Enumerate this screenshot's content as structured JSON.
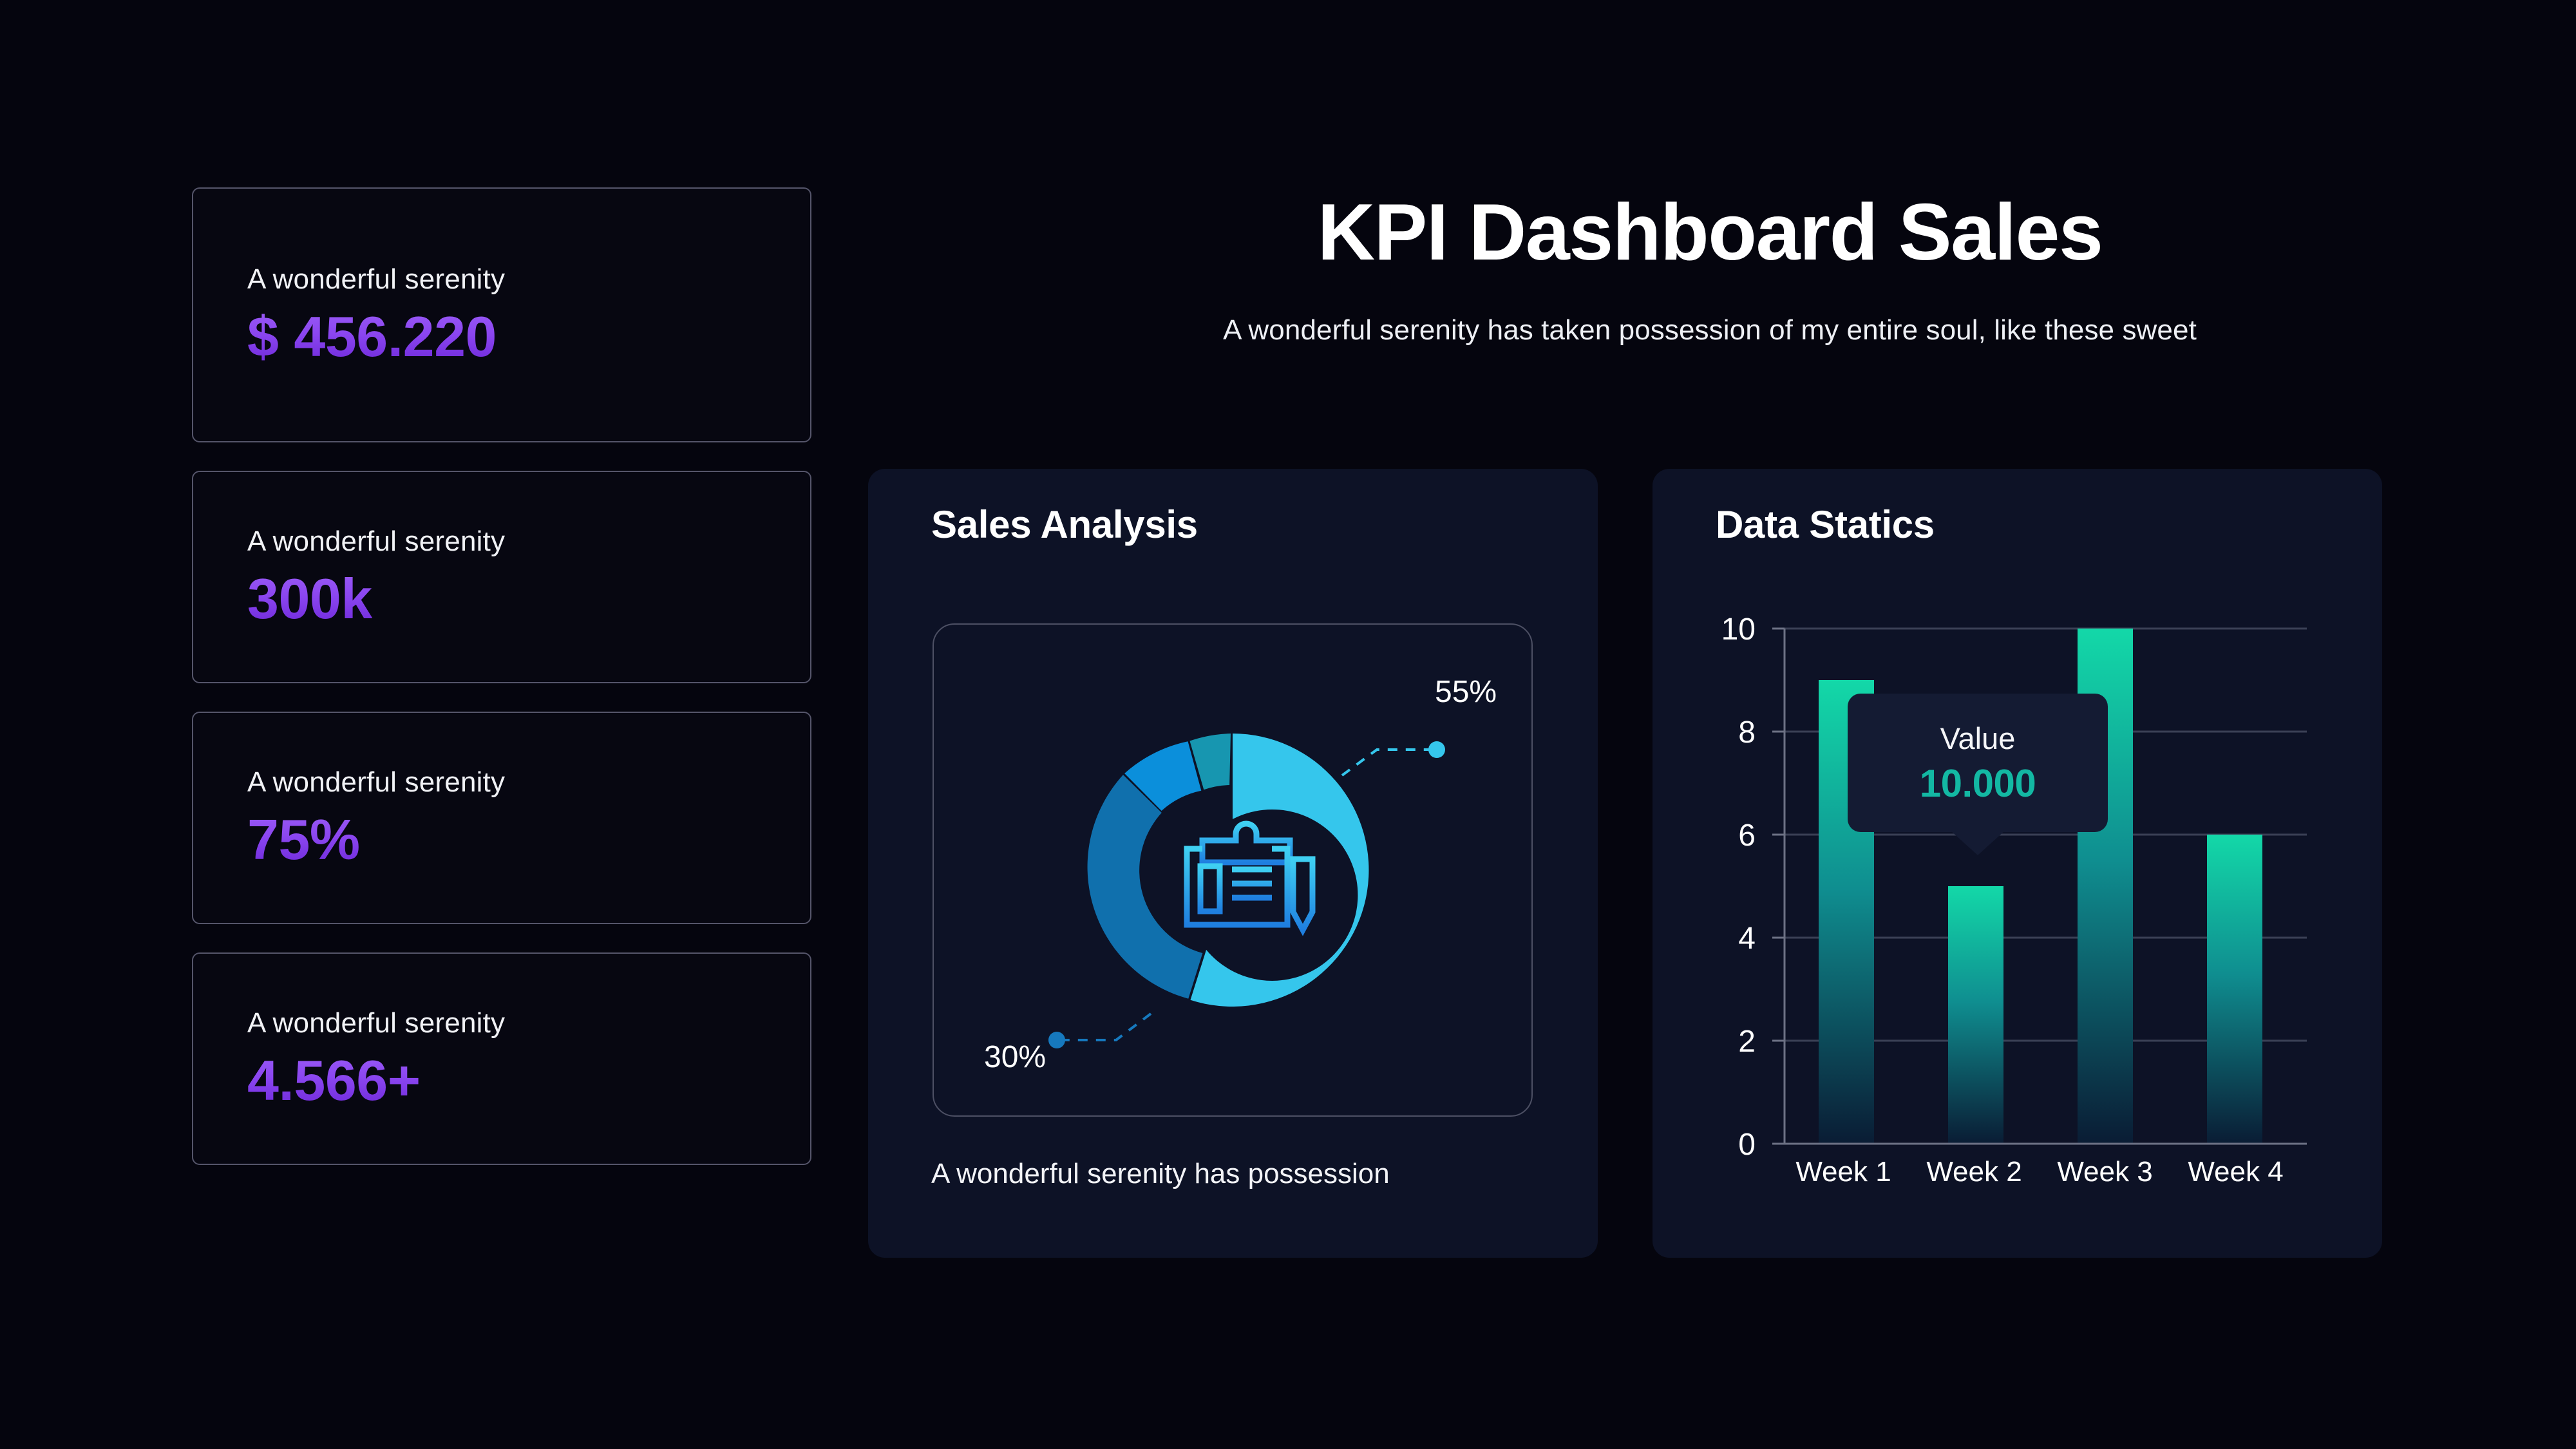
{
  "header": {
    "title": "KPI Dashboard Sales",
    "subtitle": "A wonderful serenity has taken possession of my entire soul, like these sweet"
  },
  "theme": {
    "page_bg": "#05050e",
    "panel_bg": "#0d1226",
    "kpi_accent_light": "#9b5cf6",
    "kpi_accent_dark": "#6d28d9",
    "bar_accent": "#13d8a8",
    "tooltip_accent": "#13b8a3",
    "donut_primary": "#35c6ec"
  },
  "kpi_cards": [
    {
      "label": "A wonderful serenity",
      "value": "$ 456.220"
    },
    {
      "label": "A wonderful serenity",
      "value": "300k"
    },
    {
      "label": "A wonderful serenity",
      "value": "75%"
    },
    {
      "label": "A wonderful serenity",
      "value": "4.566+"
    }
  ],
  "sales_panel": {
    "title": "Sales Analysis",
    "caption": "A wonderful serenity has possession",
    "center_icon": "clipboard-pencil-icon",
    "callouts": [
      {
        "text": "55%",
        "dot_color": "#35c6ec"
      },
      {
        "text": "30%",
        "dot_color": "#1679be"
      }
    ]
  },
  "stats_panel": {
    "title": "Data Statics",
    "tooltip": {
      "label": "Value",
      "value": "10.000"
    }
  },
  "chart_data": [
    {
      "type": "pie",
      "title": "Sales Analysis",
      "subtype": "donut",
      "labels": [
        "55%",
        "30%",
        "10%",
        "5%"
      ],
      "values": [
        55,
        30,
        10,
        5
      ],
      "colors": [
        "#35c6ec",
        "#1070ad",
        "#0b8fdb",
        "#1796b0"
      ],
      "annotations": [
        "55%",
        "30%"
      ],
      "legend": "none",
      "start_angle_deg": 0,
      "direction": "clockwise"
    },
    {
      "type": "bar",
      "title": "Data Statics",
      "categories": [
        "Week 1",
        "Week 2",
        "Week 3",
        "Week 4"
      ],
      "values": [
        9,
        5,
        10,
        6
      ],
      "xlabel": "",
      "ylabel": "",
      "ylim": [
        0,
        10
      ],
      "yticks": [
        0,
        2,
        4,
        6,
        8,
        10
      ],
      "grid": true,
      "legend": "none",
      "bar_gradient": [
        "#13d8a8",
        "#0b2240"
      ],
      "tooltip": {
        "label": "Value",
        "value": "10.000",
        "attached_to": "Week 2"
      }
    }
  ]
}
